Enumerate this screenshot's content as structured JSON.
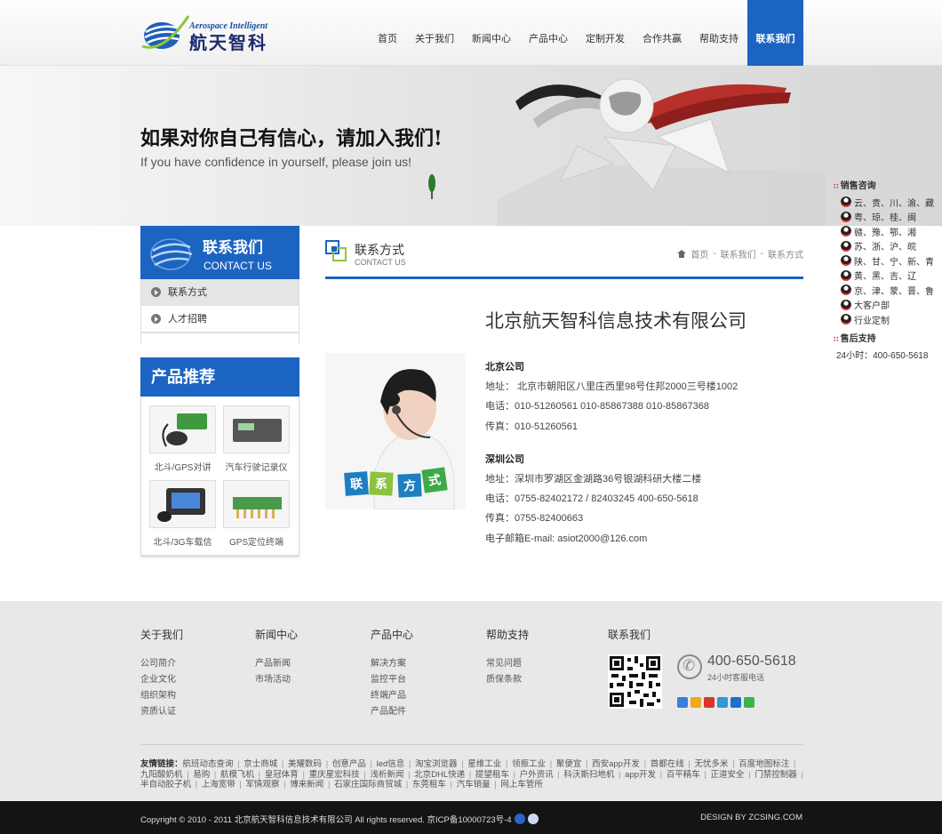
{
  "logo": {
    "en": "Aerospace Intelligent",
    "cn": "航天智科"
  },
  "nav": [
    "首页",
    "关于我们",
    "新闻中心",
    "产品中心",
    "定制开发",
    "合作共赢",
    "帮助支持",
    "联系我们"
  ],
  "banner": {
    "cn": "如果对你自己有信心，请加入我们!",
    "en": "If you have confidence in yourself, please join us!"
  },
  "float_panel": {
    "sales_title": "销售咨询",
    "qq_items": [
      "云、贵、川、渝、藏",
      "粤、琼、桂、闽",
      "赣、豫、鄂、湘",
      "苏、浙、沪、皖",
      "陕、甘、宁、新、青",
      "黄、黑、吉、辽",
      "京、津、蒙、晋、鲁",
      "大客户部",
      "行业定制"
    ],
    "support_title": "售后支持",
    "support_tel": "24小时：400-650-5618"
  },
  "sidebar": {
    "head_cn": "联系我们",
    "head_en": "CONTACT US",
    "menu": [
      "联系方式",
      "人才招聘"
    ],
    "product_head": "产品推荐",
    "products": [
      "北斗/GPS对讲",
      "汽车行驶记录仪",
      "北斗/3G车载信",
      "GPS定位终端"
    ]
  },
  "main": {
    "title_cn": "联系方式",
    "title_en": "CONTACT US",
    "breadcrumb": [
      "首页",
      "联系我们",
      "联系方式"
    ],
    "company": "北京航天智科信息技术有限公司",
    "image_label": [
      "联",
      "系",
      "方",
      "式"
    ],
    "beijing": {
      "title": "北京公司",
      "lines": [
        "地址： 北京市朝阳区八里庄西里98号住邦2000三号楼1002",
        "电话：010-51260561 010-85867388 010-85867368",
        "传真：010-51260561"
      ]
    },
    "shenzhen": {
      "title": "深圳公司",
      "lines": [
        "地址：深圳市罗湖区金湖路36号银湖科研大楼二楼",
        "电话：0755-82402172 / 82403245 400-650-5618",
        "传真：0755-82400663",
        "电子邮箱E-mail: asiot2000@126.com"
      ]
    }
  },
  "footer": {
    "cols": [
      {
        "title": "关于我们",
        "links": [
          "公司简介",
          "企业文化",
          "组织架构",
          "资质认证"
        ]
      },
      {
        "title": "新闻中心",
        "links": [
          "产品新闻",
          "市场活动"
        ]
      },
      {
        "title": "产品中心",
        "links": [
          "解决方案",
          "监控平台",
          "终端产品",
          "产品配件"
        ]
      },
      {
        "title": "帮助支持",
        "links": [
          "常见问题",
          "质保条款"
        ]
      },
      {
        "title": "联系我们",
        "links": []
      }
    ],
    "phone": "400-650-5618",
    "phone_sub": "24小时客服电话",
    "share_colors": [
      "#3a7fd5",
      "#f2a81d",
      "#d9362b",
      "#2e9ad5",
      "#1e6fd0",
      "#3ab54a"
    ],
    "links_label": "友情链接：",
    "links": [
      "航班动态查询",
      "京士商城",
      "美耀数码",
      "创意产品",
      "led信息",
      "淘宝浏览器",
      "星维工业",
      "领振工业",
      "聚便宜",
      "西安app开发",
      "首都在线",
      "无忧多米",
      "百度地图标注",
      "九阳酸奶机",
      "易购",
      "航模飞机",
      "皇冠体育",
      "重庆星宏科技",
      "浅析新闻",
      "北京DHL快递",
      "提望租车",
      "户外资讯",
      "科沃斯扫地机",
      "app开发",
      "百平精车",
      "正道安全",
      "门禁控制器",
      "半自动胶子机",
      "上海宽带",
      "军情观察",
      "博来新闻",
      "石家庄国际商贸城",
      "东莞租车",
      "汽车销量",
      "网上车管所"
    ],
    "copyright": "Copyright © 2010 - 2011 北京航天智科信息技术有限公司 All rights reserved. 京ICP备10000723号-4",
    "design": "DESIGN BY ZCSING.COM"
  }
}
